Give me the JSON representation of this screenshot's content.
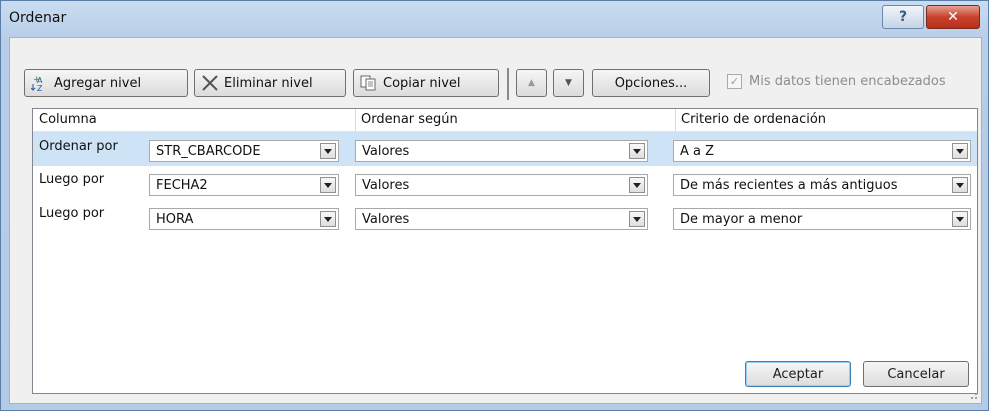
{
  "window": {
    "title": "Ordenar"
  },
  "toolbar": {
    "add_level": "Agregar nivel",
    "delete_level": "Eliminar nivel",
    "copy_level": "Copiar nivel",
    "options": "Opciones...",
    "headers_checkbox_label": "Mis datos tienen encabezados",
    "headers_checked": true
  },
  "grid": {
    "headers": [
      "Columna",
      "Ordenar según",
      "Criterio de ordenación"
    ],
    "rows": [
      {
        "label": "Ordenar por",
        "column": "STR_CBARCODE",
        "sort_on": "Valores",
        "order": "A a Z"
      },
      {
        "label": "Luego por",
        "column": "FECHA2",
        "sort_on": "Valores",
        "order": "De más recientes a más antiguos"
      },
      {
        "label": "Luego por",
        "column": "HORA",
        "sort_on": "Valores",
        "order": "De mayor a menor"
      }
    ]
  },
  "footer": {
    "ok": "Aceptar",
    "cancel": "Cancelar"
  },
  "colors": {
    "selected_row": "#cfe3f7",
    "title_bar": "#b7cde8",
    "close_button": "#c7432e"
  }
}
